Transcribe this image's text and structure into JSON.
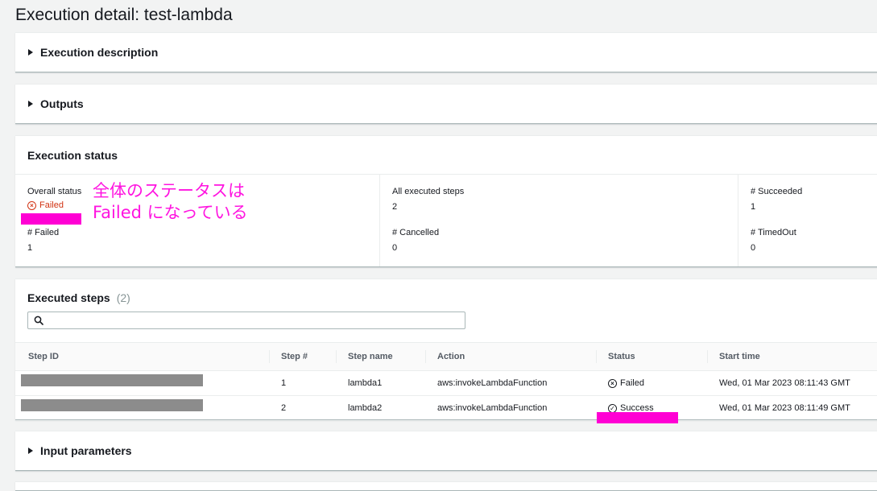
{
  "page": {
    "title": "Execution detail: test-lambda"
  },
  "sections": {
    "description": "Execution description",
    "outputs": "Outputs",
    "input_parameters": "Input parameters"
  },
  "execution_status": {
    "heading": "Execution status",
    "overall_status_label": "Overall status",
    "overall_status_value": "Failed",
    "all_executed_steps_label": "All executed steps",
    "all_executed_steps_value": "2",
    "succeeded_label": "# Succeeded",
    "succeeded_value": "1",
    "failed_label": "# Failed",
    "failed_value": "1",
    "cancelled_label": "# Cancelled",
    "cancelled_value": "0",
    "timedout_label": "# TimedOut",
    "timedout_value": "0"
  },
  "annotation": {
    "line1": "全体のステータスは",
    "line2": "Failed になっている",
    "color": "#ff14e0"
  },
  "executed_steps": {
    "title": "Executed steps",
    "count": "(2)",
    "search_placeholder": "",
    "columns": [
      "Step ID",
      "Step #",
      "Step name",
      "Action",
      "Status",
      "Start time"
    ],
    "rows": [
      {
        "step_number": "1",
        "step_name": "lambda1",
        "action": "aws:invokeLambdaFunction",
        "status": "Failed",
        "start_time": "Wed, 01 Mar 2023 08:11:43 GMT"
      },
      {
        "step_number": "2",
        "step_name": "lambda2",
        "action": "aws:invokeLambdaFunction",
        "status": "Success",
        "start_time": "Wed, 01 Mar 2023 08:11:49 GMT"
      }
    ]
  },
  "colors": {
    "failed": "#d13212",
    "success": "#1d8102",
    "highlight": "#ff00d4",
    "redaction": "#8c8c8c"
  }
}
